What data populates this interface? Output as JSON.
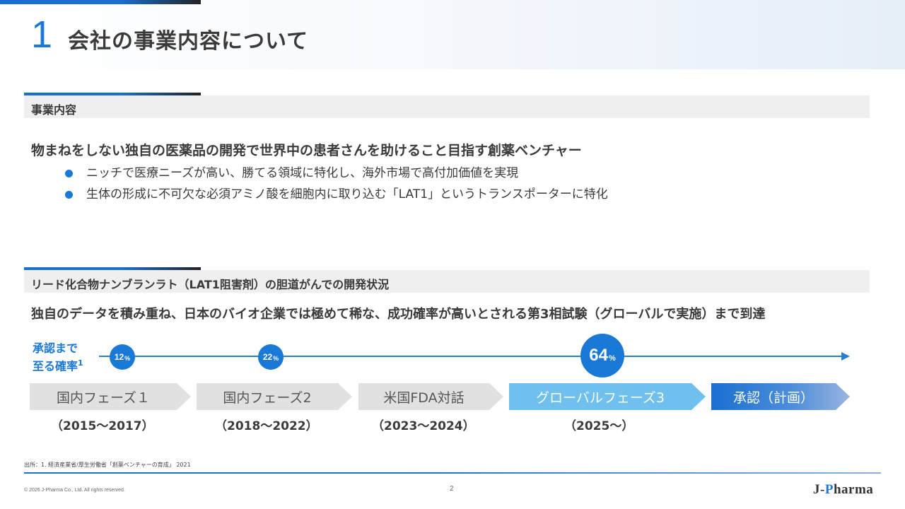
{
  "header": {
    "number": "1",
    "title": "会社の事業内容について"
  },
  "section1": {
    "label": "事業内容",
    "lead": "物まねをしない独自の医薬品の開発で世界中の患者さんを助けること目指す創薬ベンチャー",
    "bullets": [
      "ニッチで医療ニーズが高い、勝てる領域に特化し、海外市場で高付加価値を実現",
      "生体の形成に不可欠な必須アミノ酸を細胞内に取り込む「LAT1」というトランスポーターに特化"
    ]
  },
  "section2": {
    "label": "リード化合物ナンブランラト（LAT1阻害剤）の胆道がんでの開発状況",
    "lead": "独自のデータを積み重ね、日本のバイオ企業では極めて稀な、成功確率が高いとされる第3相試験（グローバルで実施）まで到達"
  },
  "timeline": {
    "prob_label_line1": "承認まで",
    "prob_label_line2": "至る確率",
    "prob_label_sup": "1",
    "probabilities": [
      {
        "value": "12",
        "unit": "%"
      },
      {
        "value": "22",
        "unit": "%"
      },
      {
        "value": "64",
        "unit": "%"
      }
    ],
    "phases": [
      {
        "label": "国内フェーズ１",
        "period": "（2015～2017）"
      },
      {
        "label": "国内フェーズ2",
        "period": "（2018～2022）"
      },
      {
        "label": "米国FDA対話",
        "period": "（2023～2024）"
      },
      {
        "label": "グローバルフェーズ3",
        "period": "（2025～）"
      },
      {
        "label": "承認（計画）",
        "period": ""
      }
    ]
  },
  "footer": {
    "footnote": "出所：1. 経済産業省/厚生労働省「創薬ベンチャーの育成」 2021",
    "copyright": "© 2026 J-Pharma Co., Ltd. All rights reserved.",
    "page_number": "2",
    "logo_prefix": "J-",
    "logo_p": "P",
    "logo_suffix": "harma"
  },
  "colors": {
    "accent": "#1a78d6",
    "phase_grey": "#e1e1e1",
    "phase_light": "#6fc0ee",
    "phase_dark": "#1a6fd0"
  }
}
